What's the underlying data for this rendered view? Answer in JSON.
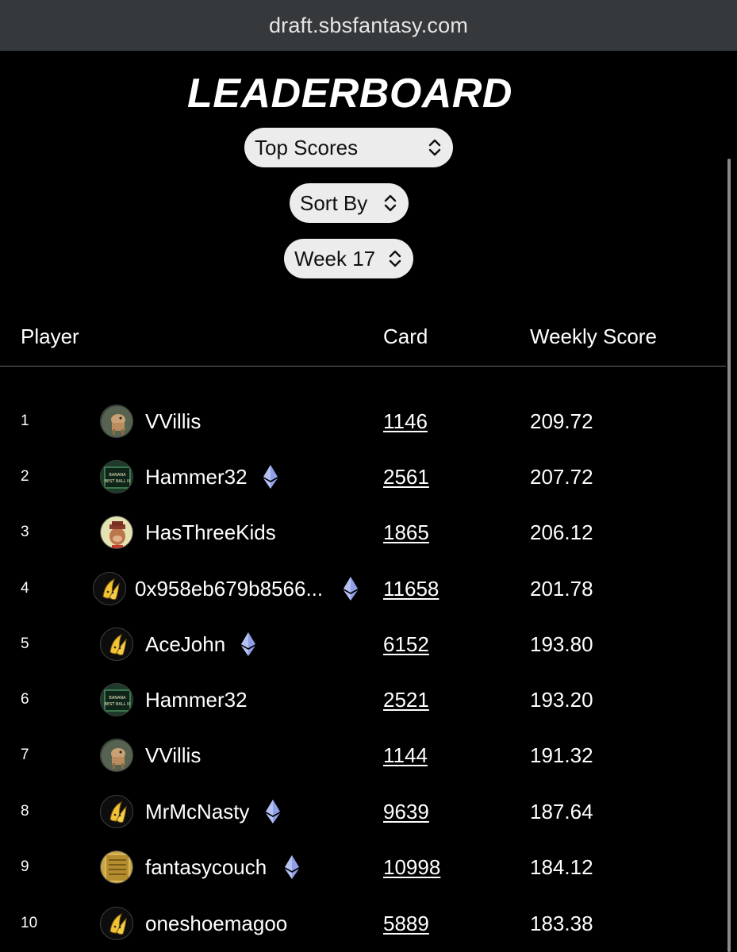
{
  "browser": {
    "url": "draft.sbsfantasy.com"
  },
  "page": {
    "title": "LEADERBOARD"
  },
  "filters": {
    "leaderboard_type": "Top Scores",
    "sort": "Sort By",
    "week": "Week 17"
  },
  "table": {
    "headers": {
      "player": "Player",
      "card": "Card",
      "score": "Weekly Score"
    },
    "rows": [
      {
        "rank": "1",
        "player": "VVillis",
        "avatar": "dog-avatar",
        "verified": false,
        "card": "1146",
        "score": "209.72"
      },
      {
        "rank": "2",
        "player": "Hammer32",
        "avatar": "banana-best-ball-avatar",
        "verified": true,
        "card": "2561",
        "score": "207.72"
      },
      {
        "rank": "3",
        "player": "HasThreeKids",
        "avatar": "ape-avatar",
        "verified": false,
        "card": "1865",
        "score": "206.12"
      },
      {
        "rank": "4",
        "player": "0x958eb679b8566...",
        "avatar": "banana-avatar",
        "verified": true,
        "card": "11658",
        "score": "201.78"
      },
      {
        "rank": "5",
        "player": "AceJohn",
        "avatar": "banana-avatar",
        "verified": true,
        "card": "6152",
        "score": "193.80"
      },
      {
        "rank": "6",
        "player": "Hammer32",
        "avatar": "banana-best-ball-avatar",
        "verified": false,
        "card": "2521",
        "score": "193.20"
      },
      {
        "rank": "7",
        "player": "VVillis",
        "avatar": "dog-avatar",
        "verified": false,
        "card": "1144",
        "score": "191.32"
      },
      {
        "rank": "8",
        "player": "MrMcNasty",
        "avatar": "banana-avatar",
        "verified": true,
        "card": "9639",
        "score": "187.64"
      },
      {
        "rank": "9",
        "player": "fantasycouch",
        "avatar": "gold-card-avatar",
        "verified": true,
        "card": "10998",
        "score": "184.12"
      },
      {
        "rank": "10",
        "player": "oneshoemagoo",
        "avatar": "banana-avatar",
        "verified": false,
        "card": "5889",
        "score": "183.38"
      }
    ]
  },
  "avatar_texts": {
    "banana_best_ball": "BANANA BEST BALL III"
  },
  "colors": {
    "background": "#000000",
    "select_bg": "#ececec",
    "eth_icon": "#8fa0e8"
  }
}
